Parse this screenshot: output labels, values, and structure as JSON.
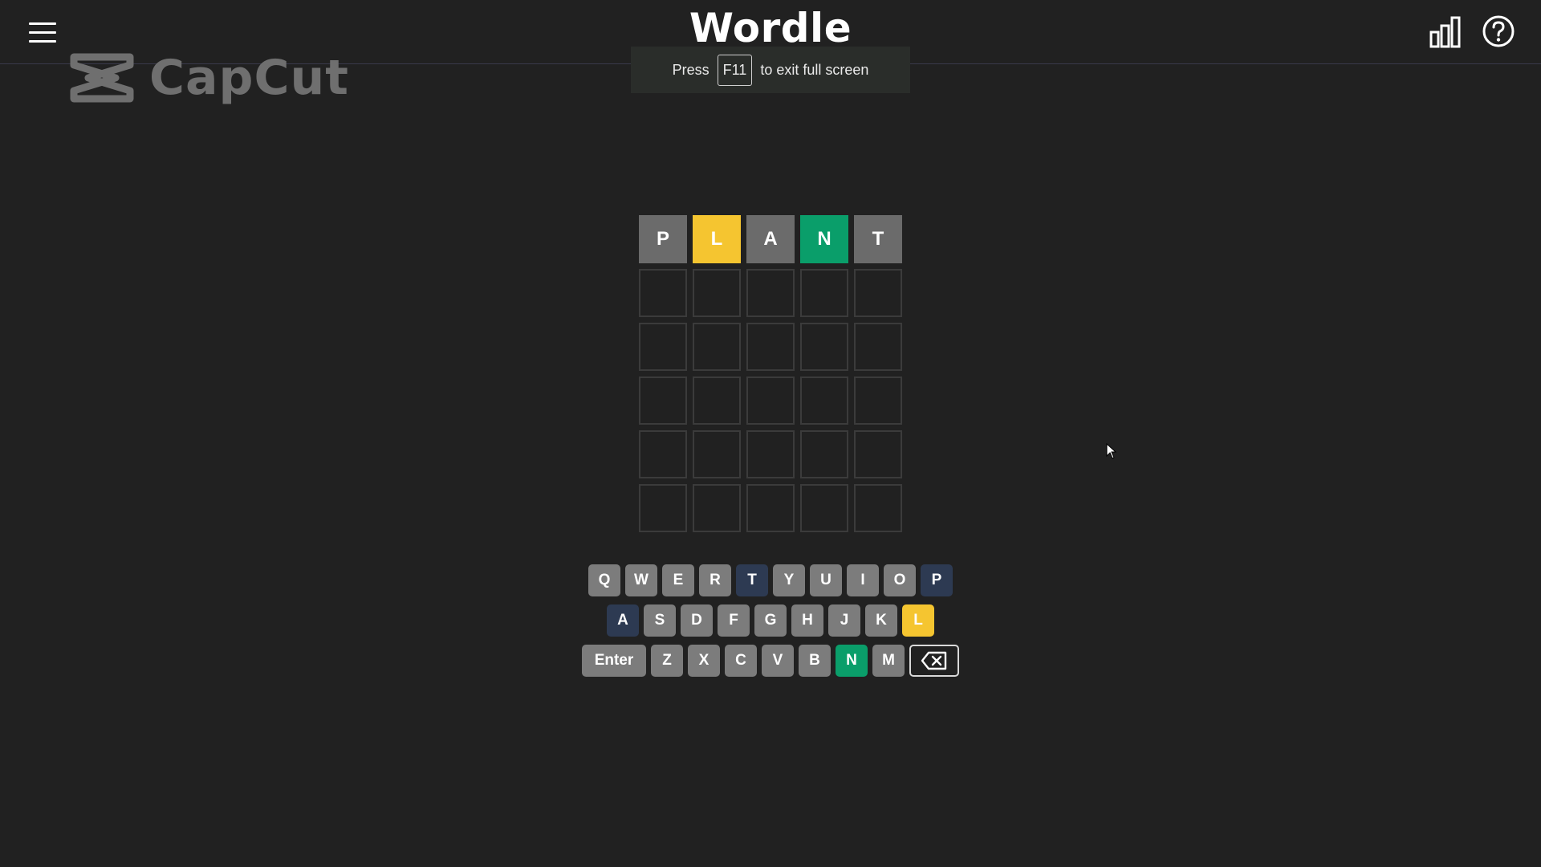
{
  "header": {
    "title": "Wordle"
  },
  "watermark": {
    "text": "CapCut"
  },
  "fullscreen_hint": {
    "before": "Press",
    "key": "F11",
    "after": "to exit full screen"
  },
  "board": {
    "rows": [
      [
        {
          "letter": "P",
          "state": "absent",
          "color": "#6b6b6b"
        },
        {
          "letter": "L",
          "state": "present",
          "color": "#f5c530"
        },
        {
          "letter": "A",
          "state": "absent",
          "color": "#6b6b6b"
        },
        {
          "letter": "N",
          "state": "correct",
          "color": "#0a9e6a"
        },
        {
          "letter": "T",
          "state": "absent",
          "color": "#6b6b6b"
        }
      ],
      [
        {
          "letter": ""
        },
        {
          "letter": ""
        },
        {
          "letter": ""
        },
        {
          "letter": ""
        },
        {
          "letter": ""
        }
      ],
      [
        {
          "letter": ""
        },
        {
          "letter": ""
        },
        {
          "letter": ""
        },
        {
          "letter": ""
        },
        {
          "letter": ""
        }
      ],
      [
        {
          "letter": ""
        },
        {
          "letter": ""
        },
        {
          "letter": ""
        },
        {
          "letter": ""
        },
        {
          "letter": ""
        }
      ],
      [
        {
          "letter": ""
        },
        {
          "letter": ""
        },
        {
          "letter": ""
        },
        {
          "letter": ""
        },
        {
          "letter": ""
        }
      ],
      [
        {
          "letter": ""
        },
        {
          "letter": ""
        },
        {
          "letter": ""
        },
        {
          "letter": ""
        },
        {
          "letter": ""
        }
      ]
    ]
  },
  "keyboard": {
    "rows": [
      [
        {
          "label": "Q",
          "state": "unused"
        },
        {
          "label": "W",
          "state": "unused"
        },
        {
          "label": "E",
          "state": "unused"
        },
        {
          "label": "R",
          "state": "unused"
        },
        {
          "label": "T",
          "state": "absent"
        },
        {
          "label": "Y",
          "state": "unused"
        },
        {
          "label": "U",
          "state": "unused"
        },
        {
          "label": "I",
          "state": "unused"
        },
        {
          "label": "O",
          "state": "unused"
        },
        {
          "label": "P",
          "state": "absent"
        }
      ],
      [
        {
          "label": "A",
          "state": "absent"
        },
        {
          "label": "S",
          "state": "unused"
        },
        {
          "label": "D",
          "state": "unused"
        },
        {
          "label": "F",
          "state": "unused"
        },
        {
          "label": "G",
          "state": "unused"
        },
        {
          "label": "H",
          "state": "unused"
        },
        {
          "label": "J",
          "state": "unused"
        },
        {
          "label": "K",
          "state": "unused"
        },
        {
          "label": "L",
          "state": "present"
        }
      ],
      [
        {
          "label": "Enter",
          "state": "unused",
          "kind": "enter"
        },
        {
          "label": "Z",
          "state": "unused"
        },
        {
          "label": "X",
          "state": "unused"
        },
        {
          "label": "C",
          "state": "unused"
        },
        {
          "label": "V",
          "state": "unused"
        },
        {
          "label": "B",
          "state": "unused"
        },
        {
          "label": "N",
          "state": "correct"
        },
        {
          "label": "M",
          "state": "unused"
        },
        {
          "label": "",
          "state": "unused",
          "kind": "backspace",
          "icon": "backspace-icon"
        }
      ]
    ]
  },
  "colors": {
    "background": "#212121",
    "unused_key": "#7c7c7c",
    "absent_key": "#2d3a52",
    "present": "#f5c530",
    "correct": "#0a9e6a",
    "absent_tile": "#6b6b6b",
    "empty_tile_border": "#3b3b3b"
  },
  "icons": {
    "menu": "hamburger-menu-icon",
    "stats": "bar-chart-icon",
    "help": "question-circle-icon",
    "watermark": "capcut-logo-icon",
    "cursor": "mouse-pointer-icon"
  }
}
